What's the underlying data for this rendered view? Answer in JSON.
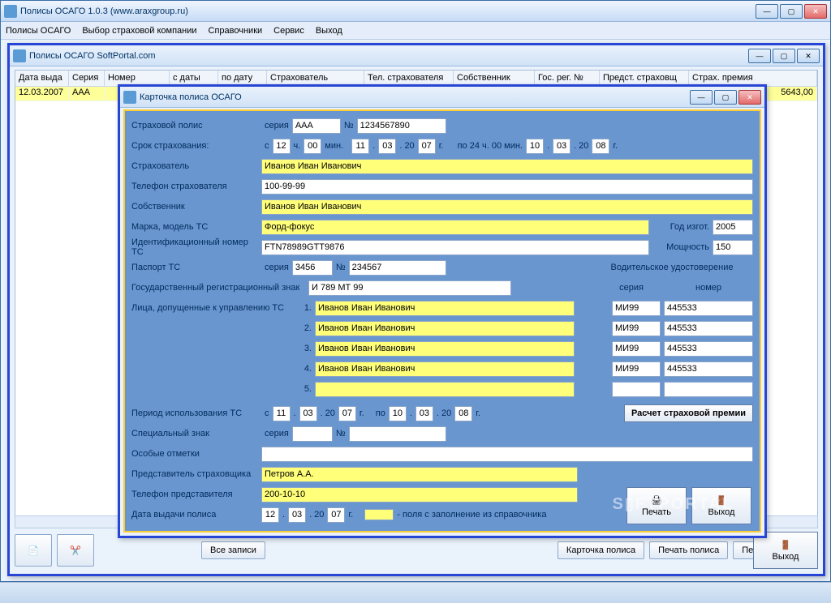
{
  "outer": {
    "title": "Полисы ОСАГО 1.0.3 (www.araxgroup.ru)"
  },
  "menu": {
    "m1": "Полисы ОСАГО",
    "m2": "Выбор страховой компании",
    "m3": "Справочники",
    "m4": "Сервис",
    "m5": "Выход"
  },
  "inner": {
    "title": "Полисы ОСАГО SoftPortal.com"
  },
  "gridh": {
    "c1": "Дата выда",
    "c2": "Серия",
    "c3": "Номер",
    "c4": "с даты",
    "c5": "по дату",
    "c6": "Страхователь",
    "c7": "Тел. страхователя",
    "c8": "Собственник",
    "c9": "Гос. рег. №",
    "c10": "Предст. страховщ",
    "c11": "Страх. премия"
  },
  "gridrow": {
    "c1": "12.03.2007",
    "c2": "ААА",
    "c11": "5643,00"
  },
  "bottom": {
    "all": "Все записи",
    "card": "Карточка полиса",
    "prnpol": "Печать полиса",
    "prnlog": "Печать журнала",
    "exit": "Выход"
  },
  "dlg": {
    "title": "Карточка полиса ОСАГО",
    "l_policy": "Страховой полис",
    "l_series": "серия",
    "series": "ААА",
    "l_num": "№",
    "num": "1234567890",
    "l_term": "Срок страхования:",
    "l_from": "с",
    "h1": "12",
    "l_h": "ч.",
    "m1": "00",
    "l_min": "мин.",
    "d1": "11",
    "mo1": "03",
    "l_20": ". 20",
    "y1": "07",
    "l_yr": "г.",
    "l_to24": "по 24 ч. 00 мин.",
    "d2": "10",
    "mo2": "03",
    "y2": "08",
    "l_insured": "Страхователь",
    "insured": "Иванов Иван Иванович",
    "l_phone": "Телефон страхователя",
    "phone": "100-99-99",
    "l_owner": "Собственник",
    "owner": "Иванов Иван Иванович",
    "l_model": "Марка, модель ТС",
    "model": "Форд-фокус",
    "l_year": "Год изгот.",
    "year": "2005",
    "l_vin": "Идентификационный номер ТС",
    "vin": "FTN78989GTT9876",
    "l_power": "Мощность",
    "power": "150",
    "l_pass": "Паспорт ТС",
    "pass_s": "3456",
    "pass_n": "234567",
    "l_reg": "Государственный регистрационный знак",
    "reg": "И 789 МТ 99",
    "l_drv": "Лица, допущенные к управлению ТС",
    "l_drvhead": "Водительское удостоверение",
    "l_drvs": "серия",
    "l_drvn": "номер",
    "n1": "1.",
    "n2": "2.",
    "n3": "3.",
    "n4": "4.",
    "n5": "5.",
    "drv": "Иванов Иван Иванович",
    "ds": "МИ99",
    "dn": "445533",
    "l_period": "Период использования ТС",
    "l_po": "по",
    "pd1": "11",
    "pm1": "03",
    "py1": "07",
    "pd2": "10",
    "pm2": "03",
    "py2": "08",
    "btn_calc": "Расчет страховой премии",
    "l_spec": "Специальный знак",
    "l_notes": "Особые отметки",
    "l_rep": "Представитель страховщика",
    "rep": "Петров А.А.",
    "l_repphone": "Телефон представителя",
    "repphone": "200-10-10",
    "l_date": "Дата выдачи полиса",
    "dd": "12",
    "dm": "03",
    "dy": "07",
    "legend": "- поля с заполнение из справочника",
    "btn_print": "Печать",
    "btn_exit": "Выход",
    "dot": "."
  }
}
